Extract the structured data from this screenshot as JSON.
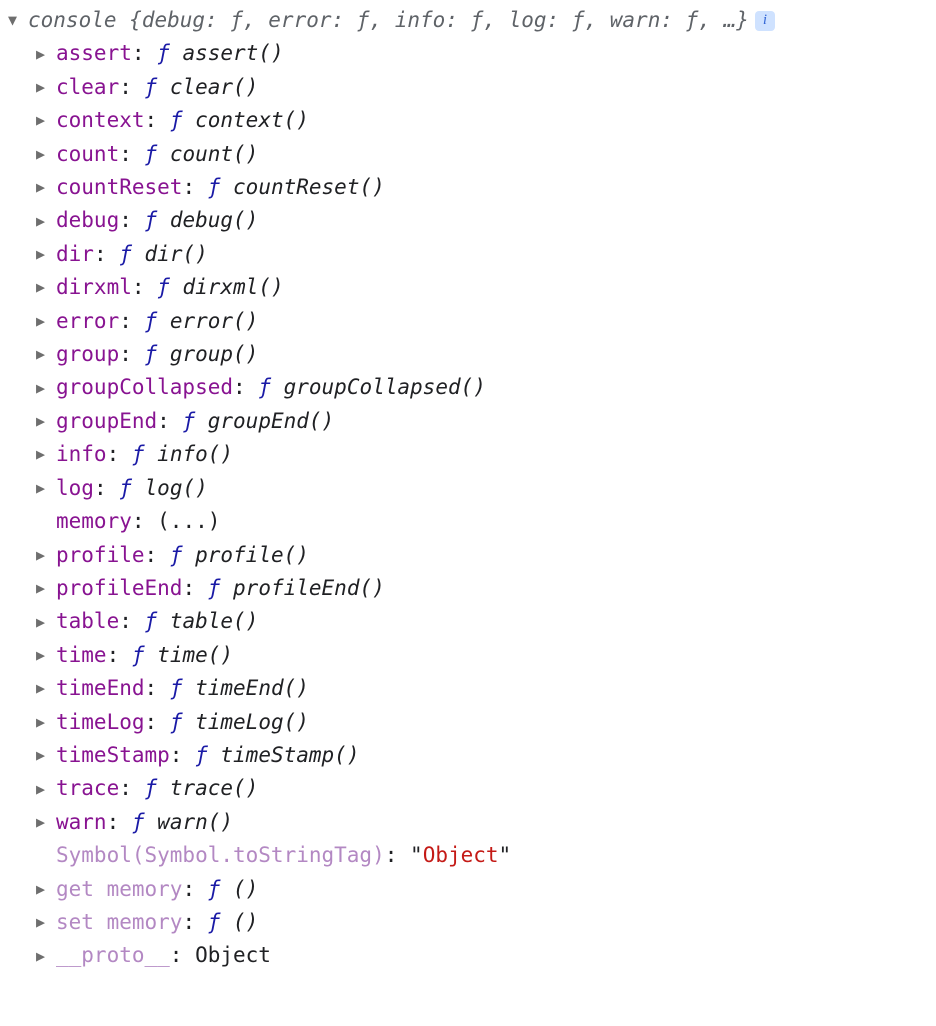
{
  "glyphs": {
    "triangle_down": "▼",
    "triangle_right": "▶",
    "f": "ƒ"
  },
  "header": {
    "object_name": "console",
    "preview_prefix": " {",
    "preview_suffix": "}",
    "preview_items": [
      {
        "key": "debug",
        "sigil": "ƒ"
      },
      {
        "key": "error",
        "sigil": "ƒ"
      },
      {
        "key": "info",
        "sigil": "ƒ"
      },
      {
        "key": "log",
        "sigil": "ƒ"
      },
      {
        "key": "warn",
        "sigil": "ƒ"
      }
    ],
    "ellipsis": "…",
    "info_badge": "i"
  },
  "props": [
    {
      "kind": "fn",
      "key": "assert",
      "fn": "assert()"
    },
    {
      "kind": "fn",
      "key": "clear",
      "fn": "clear()"
    },
    {
      "kind": "fn",
      "key": "context",
      "fn": "context()"
    },
    {
      "kind": "fn",
      "key": "count",
      "fn": "count()"
    },
    {
      "kind": "fn",
      "key": "countReset",
      "fn": "countReset()"
    },
    {
      "kind": "fn",
      "key": "debug",
      "fn": "debug()"
    },
    {
      "kind": "fn",
      "key": "dir",
      "fn": "dir()"
    },
    {
      "kind": "fn",
      "key": "dirxml",
      "fn": "dirxml()"
    },
    {
      "kind": "fn",
      "key": "error",
      "fn": "error()"
    },
    {
      "kind": "fn",
      "key": "group",
      "fn": "group()"
    },
    {
      "kind": "fn",
      "key": "groupCollapsed",
      "fn": "groupCollapsed()"
    },
    {
      "kind": "fn",
      "key": "groupEnd",
      "fn": "groupEnd()"
    },
    {
      "kind": "fn",
      "key": "info",
      "fn": "info()"
    },
    {
      "kind": "fn",
      "key": "log",
      "fn": "log()"
    },
    {
      "kind": "getter",
      "key": "memory",
      "value": "(...)"
    },
    {
      "kind": "fn",
      "key": "profile",
      "fn": "profile()"
    },
    {
      "kind": "fn",
      "key": "profileEnd",
      "fn": "profileEnd()"
    },
    {
      "kind": "fn",
      "key": "table",
      "fn": "table()"
    },
    {
      "kind": "fn",
      "key": "time",
      "fn": "time()"
    },
    {
      "kind": "fn",
      "key": "timeEnd",
      "fn": "timeEnd()"
    },
    {
      "kind": "fn",
      "key": "timeLog",
      "fn": "timeLog()"
    },
    {
      "kind": "fn",
      "key": "timeStamp",
      "fn": "timeStamp()"
    },
    {
      "kind": "fn",
      "key": "trace",
      "fn": "trace()"
    },
    {
      "kind": "fn",
      "key": "warn",
      "fn": "warn()"
    },
    {
      "kind": "symbol",
      "key": "Symbol(Symbol.toStringTag)",
      "string": "Object"
    },
    {
      "kind": "fn-dim",
      "key": "get memory",
      "fn": "()"
    },
    {
      "kind": "fn-dim",
      "key": "set memory",
      "fn": "()"
    },
    {
      "kind": "internal",
      "key": "__proto__",
      "value": "Object"
    }
  ]
}
